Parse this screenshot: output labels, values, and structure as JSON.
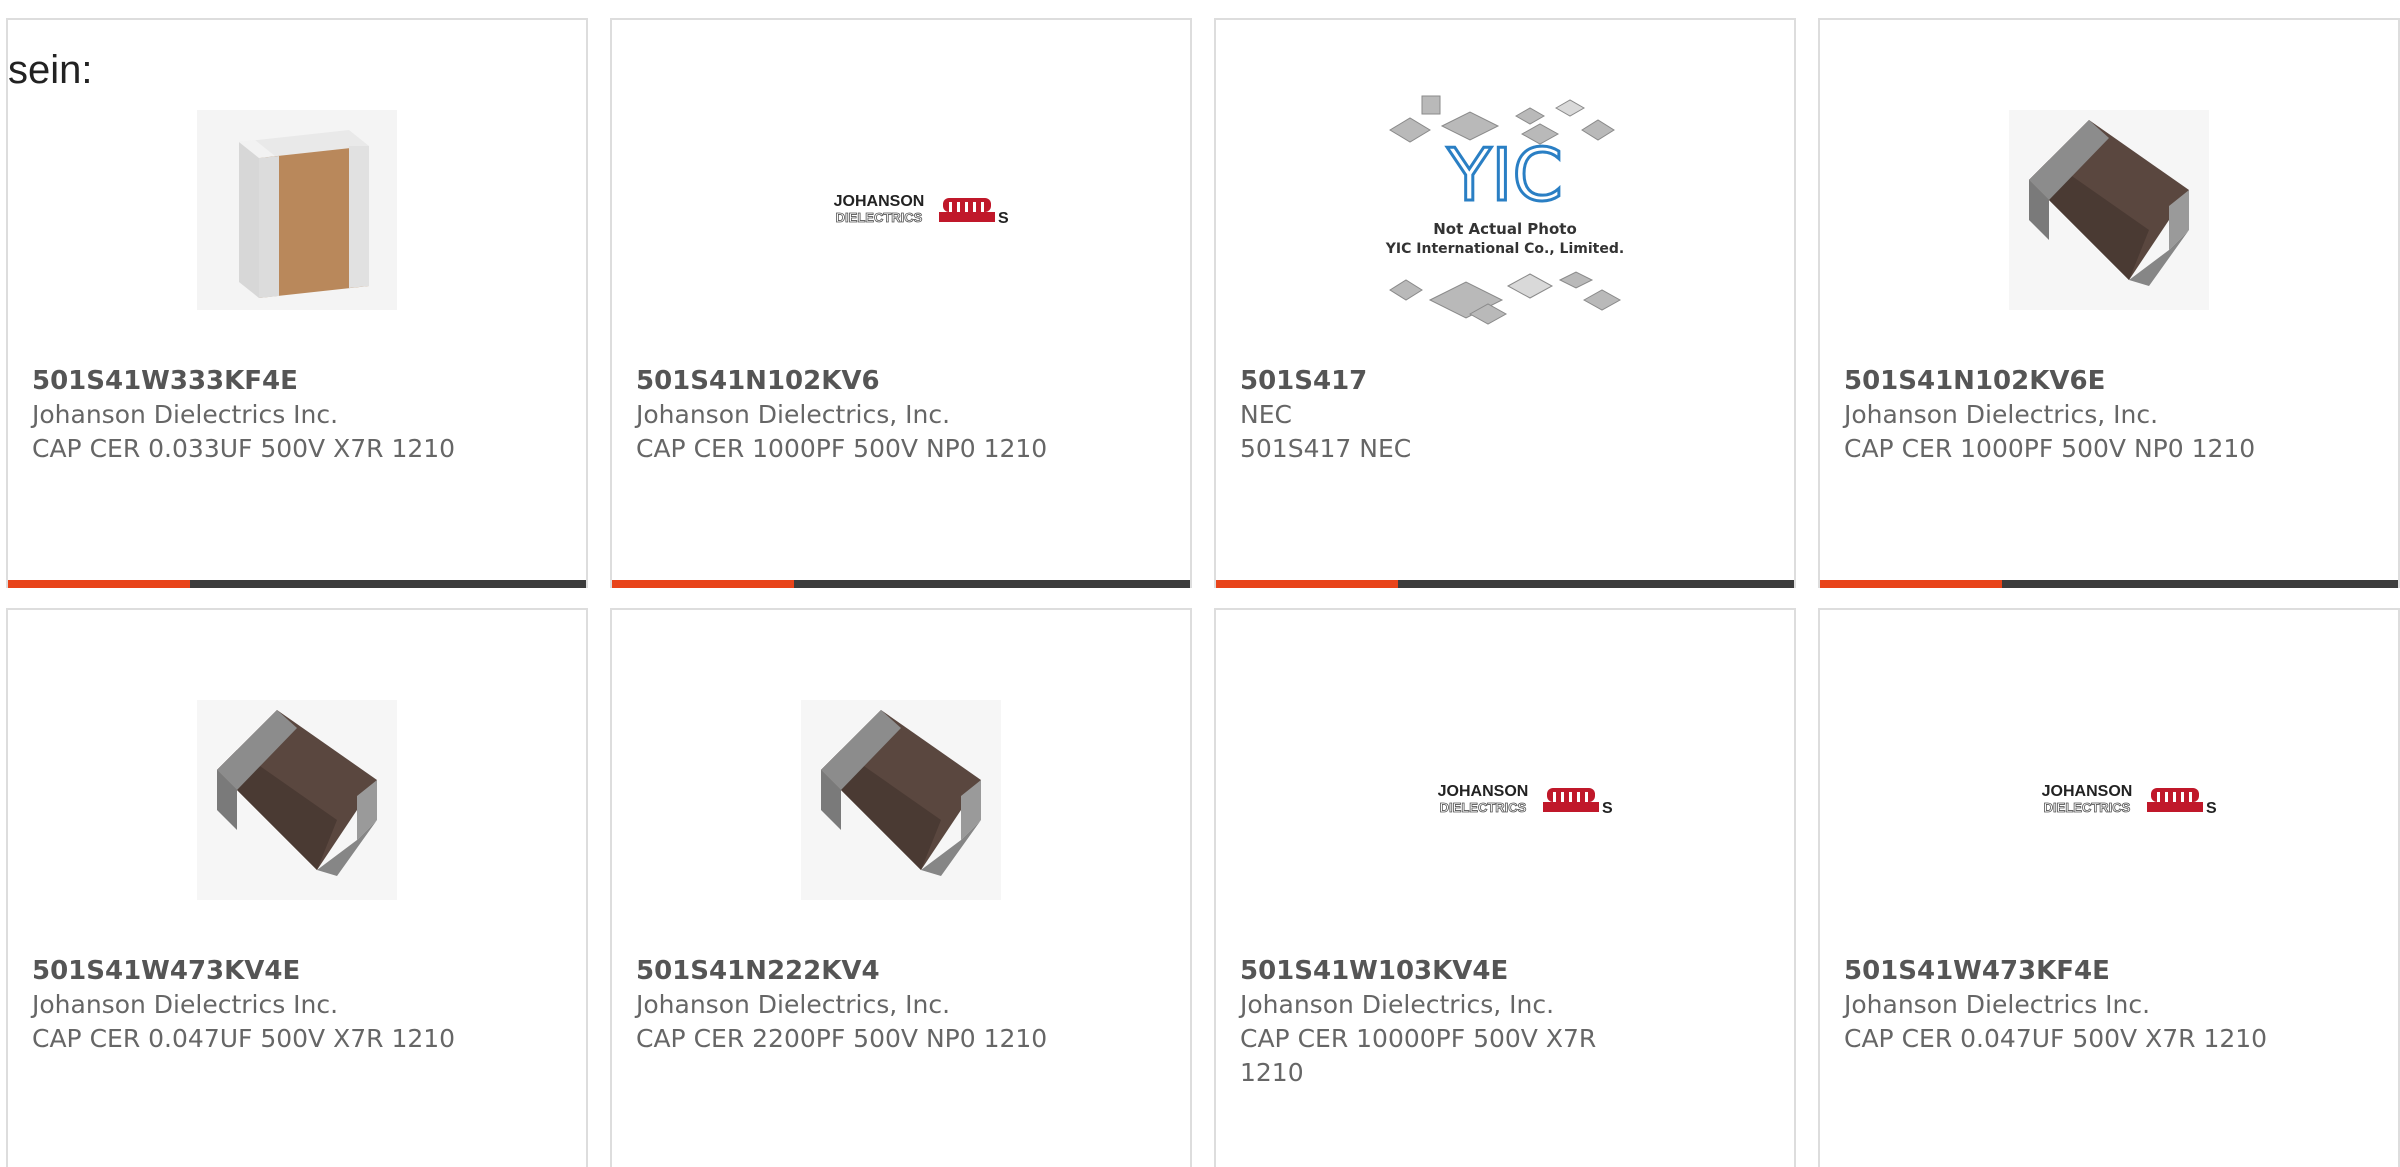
{
  "intro_text": "sein:",
  "colors": {
    "accent": "#e8441a",
    "bar": "#3c3c3c",
    "border": "#dddddd",
    "part_number": "#555555",
    "text": "#666666"
  },
  "products": [
    {
      "part_number": "501S41W333KF4E",
      "manufacturer": "Johanson Dielectrics Inc.",
      "description": "CAP CER 0.033UF 500V X7R 1210",
      "image": "tan-ceramic-chip-capacitor"
    },
    {
      "part_number": "501S41N102KV6",
      "manufacturer": "Johanson Dielectrics, Inc.",
      "description": "CAP CER 1000PF 500V NP0 1210",
      "image": "johanson-dielectrics-logo",
      "logo_text": [
        "JOHANSON",
        "DIELECTRICS"
      ]
    },
    {
      "part_number": "501S417",
      "manufacturer": "NEC",
      "description": "501S417 NEC",
      "image": "yic-placeholder",
      "placeholder_text": {
        "logo": "YIC",
        "line1": "Not Actual Photo",
        "line2": "YIC International Co., Limited."
      }
    },
    {
      "part_number": "501S41N102KV6E",
      "manufacturer": "Johanson Dielectrics, Inc.",
      "description": "CAP CER 1000PF 500V NP0 1210",
      "image": "brown-ceramic-chip-capacitor"
    },
    {
      "part_number": "501S41W473KV4E",
      "manufacturer": "Johanson Dielectrics Inc.",
      "description": "CAP CER 0.047UF 500V X7R 1210",
      "image": "brown-ceramic-chip-capacitor"
    },
    {
      "part_number": "501S41N222KV4",
      "manufacturer": "Johanson Dielectrics, Inc.",
      "description": "CAP CER 2200PF 500V NP0 1210",
      "image": "brown-ceramic-chip-capacitor"
    },
    {
      "part_number": "501S41W103KV4E",
      "manufacturer": "Johanson Dielectrics, Inc.",
      "description": "CAP CER 10000PF 500V X7R 1210",
      "image": "johanson-dielectrics-logo",
      "logo_text": [
        "JOHANSON",
        "DIELECTRICS"
      ]
    },
    {
      "part_number": "501S41W473KF4E",
      "manufacturer": "Johanson Dielectrics Inc.",
      "description": "CAP CER 0.047UF 500V X7R 1210",
      "image": "johanson-dielectrics-logo",
      "logo_text": [
        "JOHANSON",
        "DIELECTRICS"
      ]
    }
  ]
}
